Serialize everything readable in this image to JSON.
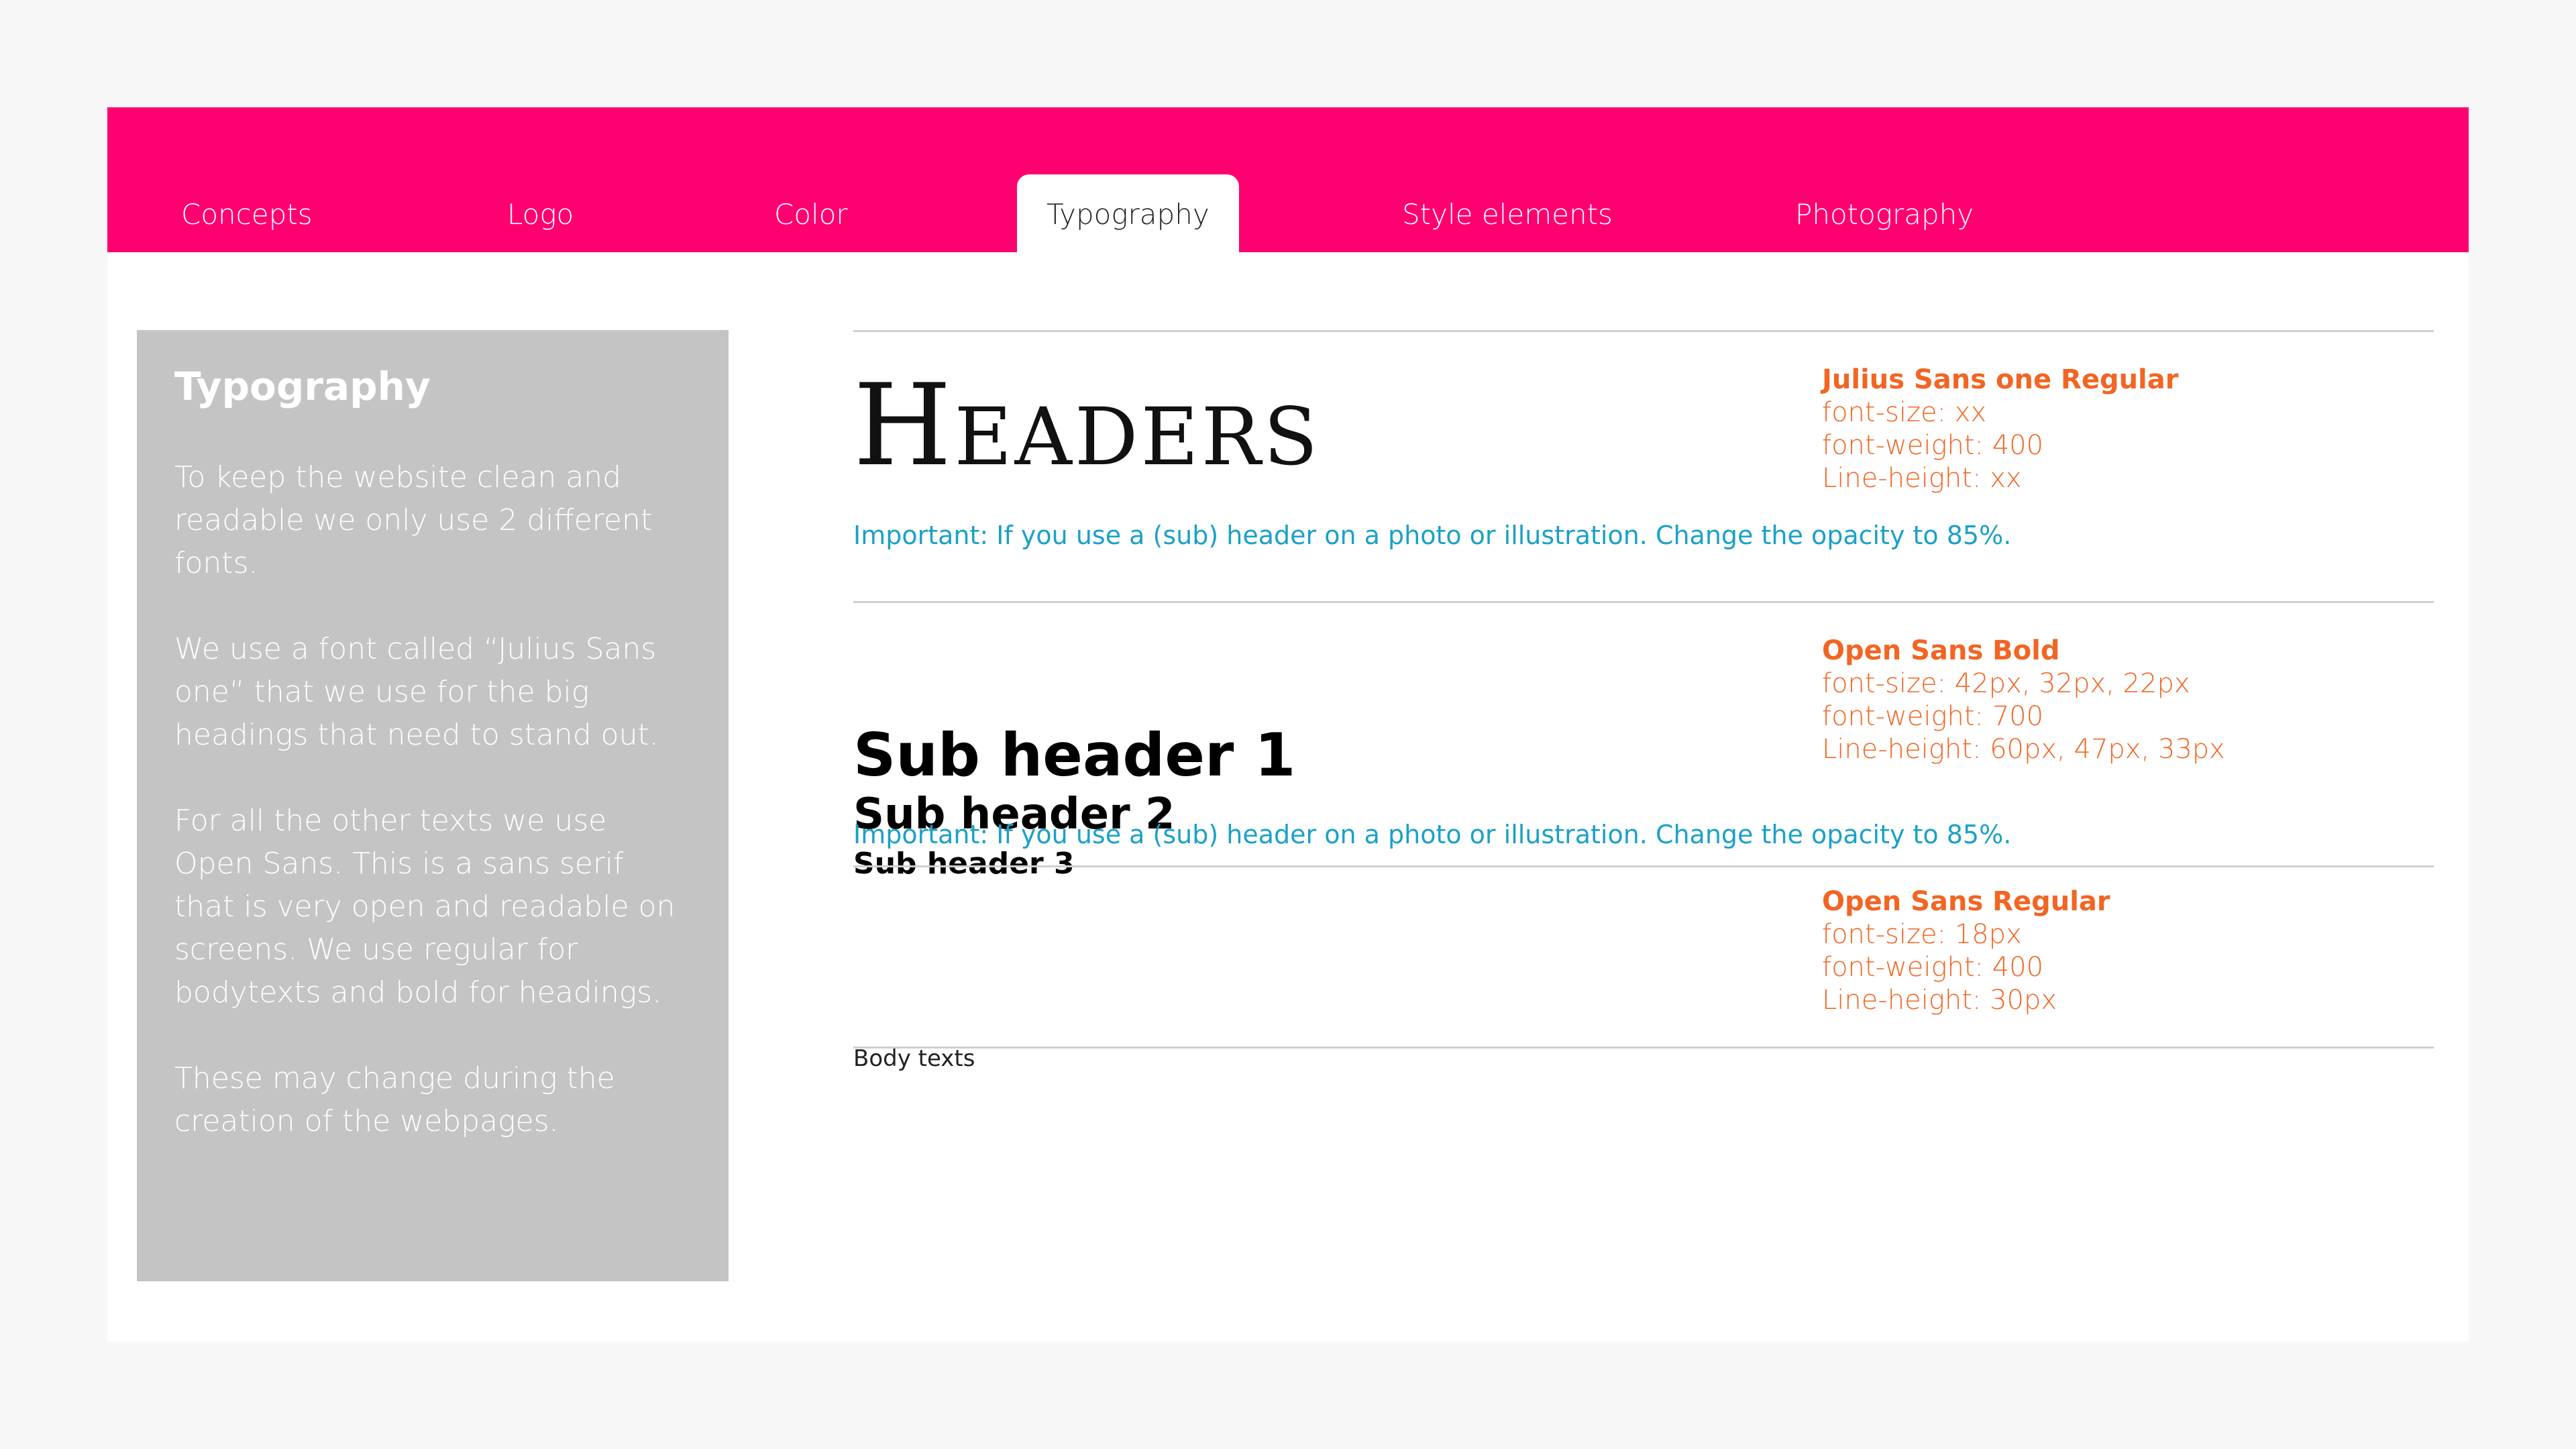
{
  "nav": {
    "tabs": [
      {
        "label": "Concepts",
        "active": false
      },
      {
        "label": "Logo",
        "active": false
      },
      {
        "label": "Color",
        "active": false
      },
      {
        "label": "Typography",
        "active": true
      },
      {
        "label": "Style elements",
        "active": false
      },
      {
        "label": "Photography",
        "active": false
      }
    ]
  },
  "sidebar": {
    "title": "Typography",
    "paragraphs": [
      "To keep the website clean and readable we only use 2 different fonts.",
      "We use a font called “Julius Sans one” that we use for the big headings that need to stand out.",
      "For all the other texts we use Open Sans. This is a sans serif that is very open and readable on screens. We use regular for bodytexts and bold for headings.",
      "These may change during the creation of the webpages."
    ]
  },
  "headers_section": {
    "sample": "Headers",
    "spec": {
      "name": "Julius Sans one Regular",
      "size": "font-size: xx",
      "weight": "font-weight: 400",
      "line_height": "Line-height: xx"
    },
    "note": "Important: If you use a (sub) header on a photo or illustration. Change the opacity to 85%."
  },
  "subheaders_section": {
    "sub1": "Sub header 1",
    "sub2": "Sub header 2",
    "sub3": "Sub header 3",
    "spec": {
      "name": "Open Sans Bold",
      "size": "font-size: 42px, 32px, 22px",
      "weight": "font-weight: 700",
      "line_height": "Line-height: 60px, 47px, 33px"
    },
    "note": "Important: If you use a (sub) header on a photo or illustration. Change the opacity to 85%."
  },
  "body_section": {
    "sample": "Body texts",
    "spec": {
      "name": "Open Sans Regular",
      "size": "font-size: 18px",
      "weight": "font-weight: 400",
      "line_height": "Line-height: 30px"
    }
  },
  "colors": {
    "nav_background": "#ff0070",
    "sidebar_background": "#c4c4c4",
    "spec_text": "#f26522",
    "note_text": "#1aa1c7"
  }
}
